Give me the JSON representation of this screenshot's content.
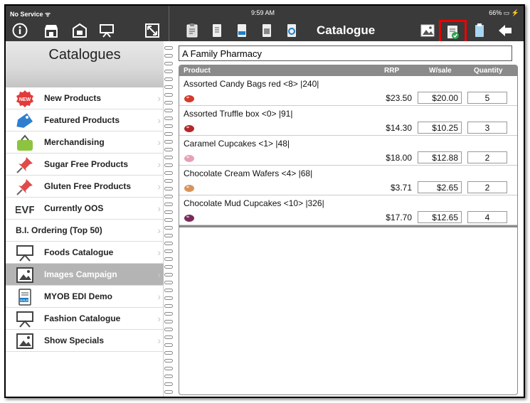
{
  "status_bar": {
    "carrier": "No Service ᯤ",
    "time": "9:59 AM",
    "battery": "66% ▭ ⚡"
  },
  "right_title": "Catalogue",
  "left_header_title": "Catalogues",
  "categories": [
    {
      "label": "New Products",
      "icon": "new-badge-icon"
    },
    {
      "label": "Featured Products",
      "icon": "price-tag-icon"
    },
    {
      "label": "Merchandising",
      "icon": "shopping-bag-icon"
    },
    {
      "label": "Sugar Free Products",
      "icon": "pushpin-icon"
    },
    {
      "label": "Gluten Free Products",
      "icon": "pushpin-icon"
    },
    {
      "label": "Currently OOS",
      "icon": "oos-icon"
    },
    {
      "label": "B.I. Ordering (Top 50)",
      "icon": ""
    },
    {
      "label": "Foods Catalogue",
      "icon": "presentation-board-icon"
    },
    {
      "label": "Images Campaign",
      "icon": "image-icon",
      "selected": true
    },
    {
      "label": "MYOB EDI Demo",
      "icon": "sale-document-icon"
    },
    {
      "label": "Fashion Catalogue",
      "icon": "presentation-board-icon"
    },
    {
      "label": "Show Specials",
      "icon": "image-icon"
    }
  ],
  "customer": "A Family Pharmacy",
  "columns": {
    "product": "Product",
    "rrp": "RRP",
    "wsale": "W/sale",
    "quantity": "Quantity"
  },
  "products": [
    {
      "name": "Assorted Candy Bags red <8> |240|",
      "rrp": "$23.50",
      "wsale": "$20.00",
      "qty": "5",
      "img_color": "#d43a2a"
    },
    {
      "name": "Assorted Truffle box <0> |91|",
      "rrp": "$14.30",
      "wsale": "$10.25",
      "qty": "3",
      "img_color": "#b5262c"
    },
    {
      "name": "Caramel Cupcakes <1> |48|",
      "rrp": "$18.00",
      "wsale": "$12.88",
      "qty": "2",
      "img_color": "#e8a0b4"
    },
    {
      "name": "Chocolate Cream Wafers <4> |68|",
      "rrp": "$3.71",
      "wsale": "$2.65",
      "qty": "2",
      "img_color": "#d9935a"
    },
    {
      "name": "Chocolate Mud Cupcakes  <10> |326|",
      "rrp": "$17.70",
      "wsale": "$12.65",
      "qty": "4",
      "img_color": "#7a2a5a"
    }
  ],
  "toolbar_icons": [
    "info-icon",
    "store-icon",
    "warehouse-icon",
    "presentation-icon",
    "resize-icon",
    "order-form-icon",
    "document-icon",
    "sale-document-icon",
    "print-icon",
    "sync-icon",
    "image-icon",
    "checked-order-icon",
    "clipboard-icon",
    "back-arrow-icon"
  ],
  "colors": {
    "topbar": "#3a3a3a",
    "highlight": "#e00000",
    "table_header": "#8a8a8a",
    "selected_row": "#b4b4b4"
  }
}
